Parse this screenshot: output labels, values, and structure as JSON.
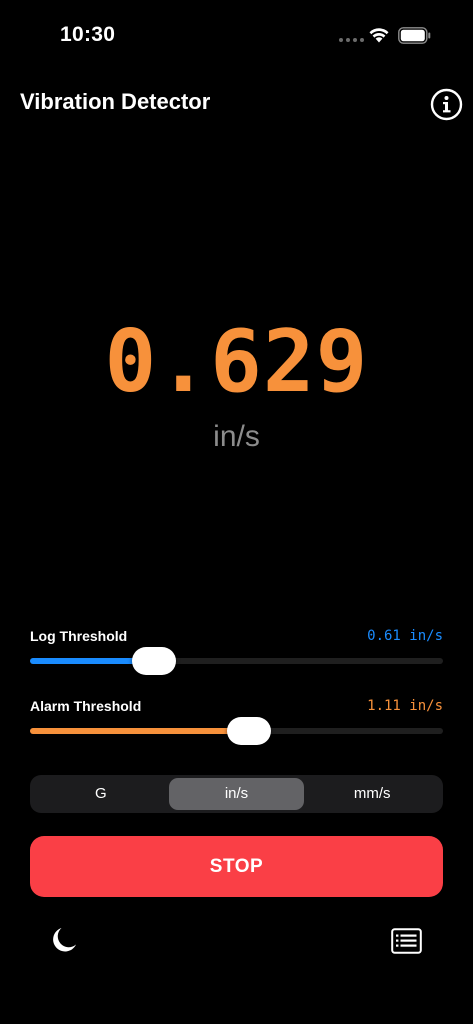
{
  "status_bar": {
    "time": "10:30"
  },
  "header": {
    "title": "Vibration Detector",
    "info_icon": "info-circle-icon"
  },
  "reading": {
    "value": "0.629",
    "unit": "in/s",
    "color": "#f7913b"
  },
  "log_threshold": {
    "label": "Log Threshold",
    "value_text": "0.61 in/s",
    "color": "#1a8cff",
    "level_fraction": 0.3
  },
  "alarm_threshold": {
    "label": "Alarm Threshold",
    "value_text": "1.11 in/s",
    "color": "#f7913b",
    "level_fraction": 0.53
  },
  "units_control": {
    "options": [
      "G",
      "in/s",
      "mm/s"
    ],
    "selected": "in/s"
  },
  "stop_button": {
    "label": "STOP",
    "color": "#fa3f46"
  },
  "bottom_bar": {
    "left_icon": "moon-icon",
    "right_icon": "log-list-icon"
  }
}
